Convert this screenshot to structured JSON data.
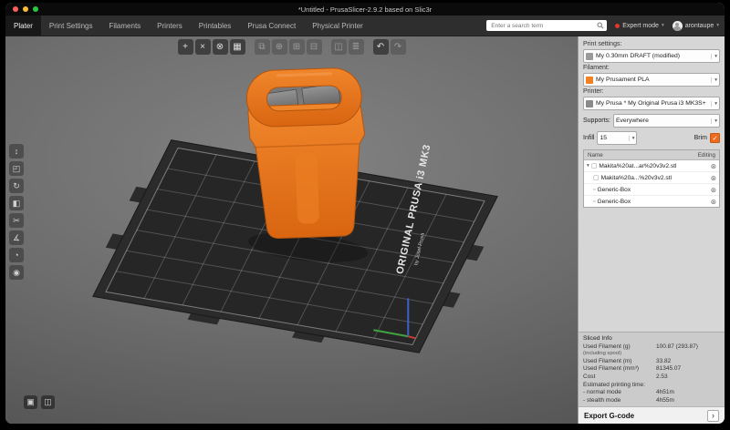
{
  "window": {
    "title": "*Untitled - PrusaSlicer-2.9.2 based on Slic3r"
  },
  "topbar": {
    "tabs": [
      {
        "label": "Plater"
      },
      {
        "label": "Print Settings"
      },
      {
        "label": "Filaments"
      },
      {
        "label": "Printers"
      },
      {
        "label": "Printables"
      },
      {
        "label": "Prusa Connect"
      },
      {
        "label": "Physical Printer"
      }
    ],
    "search_placeholder": "Enter a search term",
    "mode_label": "Expert mode",
    "user_name": "arontaupe"
  },
  "toolbar": {
    "items": [
      {
        "name": "add",
        "glyph": "+"
      },
      {
        "name": "delete",
        "glyph": "×"
      },
      {
        "name": "delete-all",
        "glyph": "⊗"
      },
      {
        "name": "arrange",
        "glyph": "▦"
      },
      {
        "name": "copy",
        "glyph": "⧉"
      },
      {
        "name": "paste",
        "glyph": "⊕"
      },
      {
        "name": "add-instance",
        "glyph": "⊞"
      },
      {
        "name": "remove-instance",
        "glyph": "⊟"
      },
      {
        "name": "split-objects",
        "glyph": "◫"
      },
      {
        "name": "variable-layer-height",
        "glyph": "≣"
      },
      {
        "name": "undo",
        "glyph": "↶"
      },
      {
        "name": "redo",
        "glyph": "↷"
      }
    ]
  },
  "left_toolbar": {
    "items": [
      {
        "name": "move",
        "glyph": "↕"
      },
      {
        "name": "scale",
        "glyph": "◰"
      },
      {
        "name": "rotate",
        "glyph": "↻"
      },
      {
        "name": "place-on-face",
        "glyph": "◧"
      },
      {
        "name": "cut",
        "glyph": "✂"
      },
      {
        "name": "measure",
        "glyph": "∡"
      },
      {
        "name": "paint-supports",
        "glyph": "◔"
      },
      {
        "name": "seam",
        "glyph": "◉"
      }
    ]
  },
  "view_toolbar": {
    "items": [
      {
        "name": "view-solid",
        "glyph": "▣"
      },
      {
        "name": "view-sliced",
        "glyph": "◫"
      }
    ]
  },
  "viewport": {
    "bed_text": "ORIGINAL PRUSA i3 MK3",
    "bed_credit": "by Josef Prusa"
  },
  "icons": {
    "caret_down": "▾",
    "expander": "▾",
    "check": "✓",
    "gear": "⊛",
    "object": "▢",
    "modifier": "▫",
    "export_arrow": "›"
  },
  "sidebar": {
    "print_settings": {
      "label": "Print settings:",
      "value": "My 0.30mm DRAFT (modified)"
    },
    "filament": {
      "label": "Filament:",
      "value": "My Prusament PLA"
    },
    "printer": {
      "label": "Printer:",
      "value": "My Prusa * My Original Prusa i3 MK3S+"
    },
    "supports": {
      "label": "Supports:",
      "value": "Everywhere"
    },
    "infill": {
      "label": "Infill",
      "value": "15"
    },
    "brim": {
      "label": "Brim"
    },
    "object_list": {
      "columns": {
        "name": "Name",
        "editing": "Editing"
      },
      "rows": [
        {
          "name": "Makita%20at...ar%20v3v2.stl"
        },
        {
          "name": "Makita%20a...%20v3v2.stl"
        },
        {
          "name": "Generic-Box"
        },
        {
          "name": "Generic-Box"
        }
      ]
    },
    "sliced_info": {
      "title": "Sliced Info",
      "filament_g_label": "Used Filament (g)",
      "filament_g_sub": "(including spool)",
      "filament_g_value": "100.87 (293.87)",
      "filament_m_label": "Used Filament (m)",
      "filament_m_value": "33.82",
      "filament_mm3_label": "Used Filament (mm³)",
      "filament_mm3_value": "81345.07",
      "cost_label": "Cost",
      "cost_value": "2.53",
      "time_header": "Estimated printing time:",
      "normal_label": "- normal mode",
      "normal_value": "4h51m",
      "stealth_label": "- stealth mode",
      "stealth_value": "4h55m"
    },
    "export_label": "Export G-code"
  },
  "colors": {
    "accent": "#ed6b21",
    "filament_swatch": "#f08124",
    "bed": "#2b2b2b"
  }
}
